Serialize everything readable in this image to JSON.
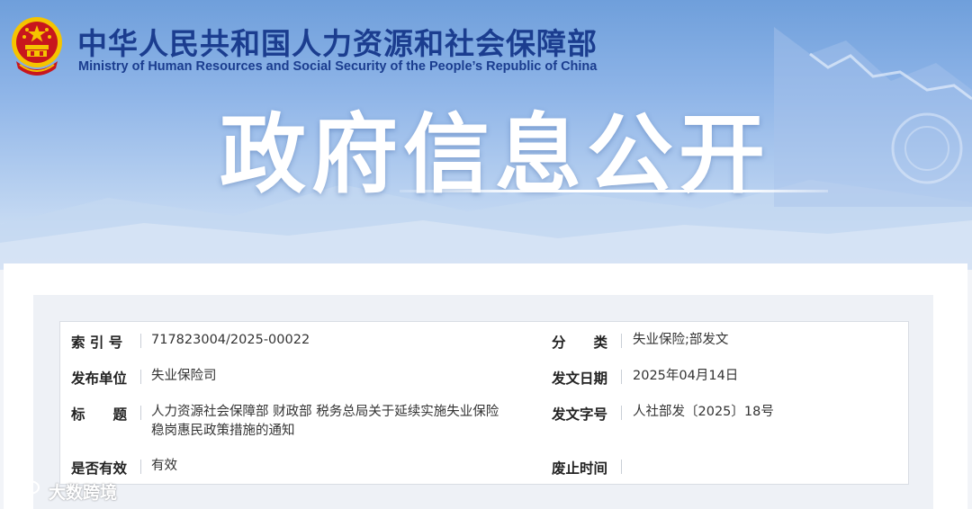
{
  "header": {
    "org_name_cn": "中华人民共和国人力资源和社会保障部",
    "org_name_en": "Ministry of Human Resources and Social Security of the People’s Republic of China",
    "section_title": "政府信息公开",
    "emblem_icon": "national-emblem-icon"
  },
  "info": {
    "index_label": "索 引 号",
    "index_value": "717823004/2025-00022",
    "category_label": "分　　类",
    "category_value": "失业保险;部发文",
    "issuer_label": "发布单位",
    "issuer_value": "失业保险司",
    "date_label": "发文日期",
    "date_value": "2025年04月14日",
    "title_label": "标　　题",
    "title_value_line1": "人力资源社会保障部 财政部 税务总局关于延续实施失业保险",
    "title_value_line2": "稳岗惠民政策措施的通知",
    "doc_no_label": "发文字号",
    "doc_no_value": "人社部发〔2025〕18号",
    "validity_label": "是否有效",
    "validity_value": "有效",
    "abolish_label": "废止时间",
    "abolish_value": ""
  },
  "watermark": {
    "text": "大数跨境",
    "icon": "wechat-logo-icon"
  },
  "colors": {
    "brand_blue": "#1b3d8f",
    "banner_blue": "#8fb5e8",
    "emblem_red": "#c8161d",
    "emblem_gold": "#f5c400"
  }
}
